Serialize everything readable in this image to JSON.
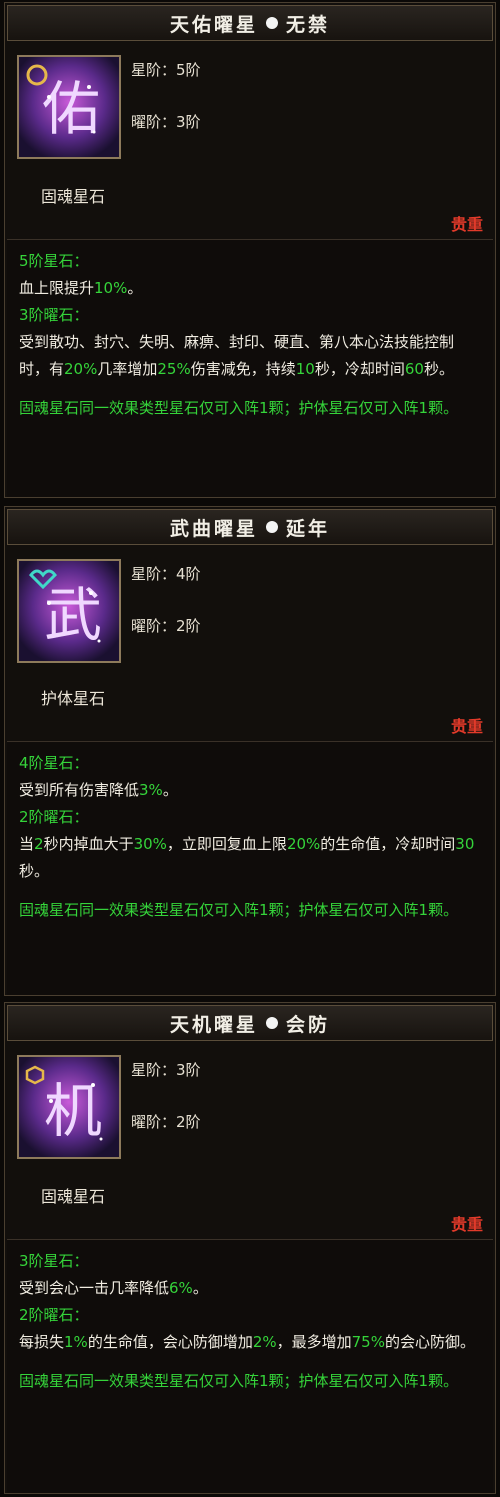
{
  "colors": {
    "green": "#35d43a",
    "red": "#e23a2a",
    "title": "#f2efe6"
  },
  "panels": [
    {
      "title_left": "天佑曜星",
      "title_right": "无禁",
      "icon_name": "tian-you-glyph-icon",
      "icon_char": "佑",
      "star_rank": "星阶：5阶",
      "yao_rank": "曜阶：3阶",
      "stone_type": "固魂星石",
      "rarity": "贵重",
      "star_header": "5阶星石：",
      "star_effect_pre": "血上限提升",
      "star_effect_val": "10%",
      "star_effect_post": "。",
      "yao_header": "3阶曜石：",
      "yao_effect": [
        {
          "t": "受到散功、封穴、失明、麻痹、封印、硬直、第八本心法技能控制时，有",
          "g": false
        },
        {
          "t": "20%",
          "g": true
        },
        {
          "t": "几率增加",
          "g": false
        },
        {
          "t": "25%",
          "g": true
        },
        {
          "t": "伤害减免，持续",
          "g": false
        },
        {
          "t": "10",
          "g": true
        },
        {
          "t": "秒，冷却时间",
          "g": false
        },
        {
          "t": "60",
          "g": true
        },
        {
          "t": "秒。",
          "g": false
        }
      ],
      "note": "固魂星石同一效果类型星石仅可入阵1颗；护体星石仅可入阵1颗。"
    },
    {
      "title_left": "武曲曜星",
      "title_right": "延年",
      "icon_name": "wu-qu-glyph-icon",
      "icon_char": "武",
      "star_rank": "星阶：4阶",
      "yao_rank": "曜阶：2阶",
      "stone_type": "护体星石",
      "rarity": "贵重",
      "star_header": "4阶星石：",
      "star_effect_pre": "受到所有伤害降低",
      "star_effect_val": "3%",
      "star_effect_post": "。",
      "yao_header": "2阶曜石：",
      "yao_effect": [
        {
          "t": "当",
          "g": false
        },
        {
          "t": "2",
          "g": true
        },
        {
          "t": "秒内掉血大于",
          "g": false
        },
        {
          "t": "30%",
          "g": true
        },
        {
          "t": "，立即回复血上限",
          "g": false
        },
        {
          "t": "20%",
          "g": true
        },
        {
          "t": "的生命值，冷却时间",
          "g": false
        },
        {
          "t": "30",
          "g": true
        },
        {
          "t": "秒。",
          "g": false
        }
      ],
      "note": "固魂星石同一效果类型星石仅可入阵1颗；护体星石仅可入阵1颗。"
    },
    {
      "title_left": "天机曜星",
      "title_right": "会防",
      "icon_name": "tian-ji-glyph-icon",
      "icon_char": "机",
      "star_rank": "星阶：3阶",
      "yao_rank": "曜阶：2阶",
      "stone_type": "固魂星石",
      "rarity": "贵重",
      "star_header": "3阶星石：",
      "star_effect_pre": "受到会心一击几率降低",
      "star_effect_val": "6%",
      "star_effect_post": "。",
      "yao_header": "2阶曜石：",
      "yao_effect": [
        {
          "t": "每损失",
          "g": false
        },
        {
          "t": "1%",
          "g": true
        },
        {
          "t": "的生命值，会心防御增加",
          "g": false
        },
        {
          "t": "2%",
          "g": true
        },
        {
          "t": "，最多增加",
          "g": false
        },
        {
          "t": "75%",
          "g": true
        },
        {
          "t": "的会心防御。",
          "g": false
        }
      ],
      "note": "固魂星石同一效果类型星石仅可入阵1颗；护体星石仅可入阵1颗。"
    }
  ]
}
